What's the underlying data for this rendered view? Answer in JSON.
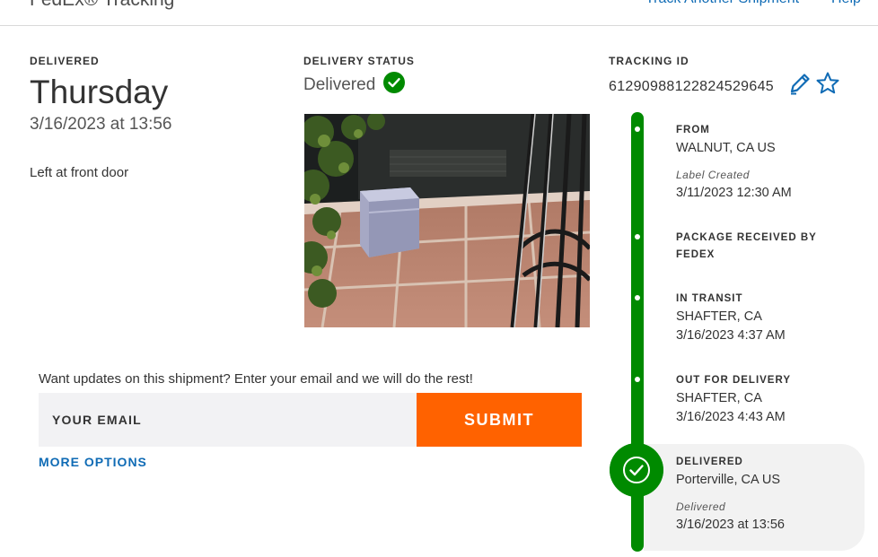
{
  "header": {
    "brand": "FedEx® Tracking",
    "track_another": "Track Another Shipment",
    "help": "Help"
  },
  "delivered_panel": {
    "label": "DELIVERED",
    "day": "Thursday",
    "datetime": "3/16/2023 at 13:56",
    "note": "Left at front door"
  },
  "status_panel": {
    "label": "DELIVERY STATUS",
    "value": "Delivered"
  },
  "tracking_panel": {
    "label": "TRACKING ID",
    "number": "612909881228245296​45"
  },
  "updates": {
    "prompt": "Want updates on this shipment? Enter your email and we will do the rest!",
    "email_label": "YOUR EMAIL",
    "submit": "SUBMIT",
    "more_options": "MORE OPTIONS"
  },
  "timeline": {
    "from": {
      "title": "FROM",
      "location": "WALNUT, CA US",
      "sub": "Label Created",
      "time": "3/11/2023 12:30 AM"
    },
    "received": {
      "line1": "PACKAGE RECEIVED BY",
      "line2": "FEDEX"
    },
    "transit": {
      "title": "IN TRANSIT",
      "location": "SHAFTER, CA",
      "time": "3/16/2023 4:37 AM"
    },
    "out": {
      "title": "OUT FOR DELIVERY",
      "location": "SHAFTER, CA",
      "time": "3/16/2023 4:43 AM"
    },
    "delivered": {
      "title": "DELIVERED",
      "location": "Porterville, CA US",
      "sub": "Delivered",
      "time": "3/16/2023 at 13:56"
    }
  },
  "colors": {
    "accent_green": "#008a00",
    "submit_orange": "#ff6200",
    "link_blue": "#0f6bb5"
  },
  "icons": [
    "check-circle-icon",
    "pencil-icon",
    "star-icon",
    "check-circle-large-icon"
  ]
}
